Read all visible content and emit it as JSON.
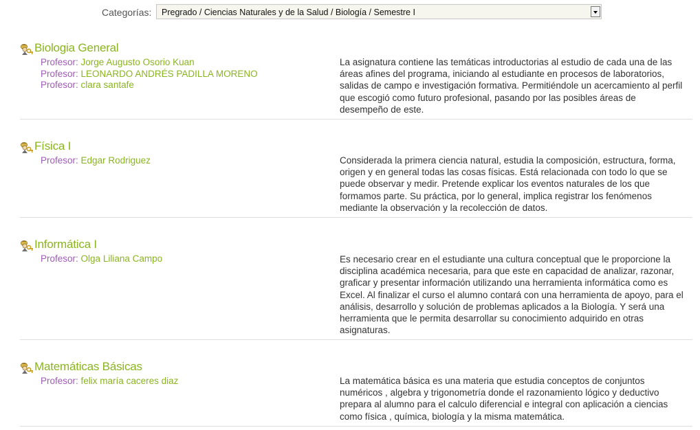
{
  "categories": {
    "label": "Categorías:",
    "selected": "Pregrado / Ciencias Naturales y de la Salud / Biología / Semestre I"
  },
  "teacher_label": "Profesor:",
  "courses": [
    {
      "name": "Biologia General",
      "teachers": [
        "Jorge Augusto Osorio Kuan",
        "LEONARDO ANDRÉS PADILLA MORENO",
        "clara santafe"
      ],
      "summary": "La asignatura contiene las temáticas introductorias al estudio  de cada una de las áreas afines del programa, iniciando al estudiante en procesos de laboratorios,  salidas de campo e investigación formativa. Permitiéndole un acercamiento al perfil que escogió como futuro profesional, pasando por las posibles áreas de desempeño de este."
    },
    {
      "name": "Física I",
      "teachers": [
        "Edgar Rodriguez"
      ],
      "summary": "Considerada la primera ciencia natural, estudia la composición, estructura, forma, origen y en general todas las cosas físicas. Está relacionada con todo lo que se puede observar  y medir. Pretende explicar los eventos naturales de los que formamos parte. Su práctica, por lo general, implica registrar los fenómenos mediante la observación y la recolección de datos."
    },
    {
      "name": "Informática I",
      "teachers": [
        "Olga Liliana Campo"
      ],
      "summary": "Es necesario crear en el estudiante una cultura conceptual que le proporcione la disciplina académica necesaria, para que este en capacidad de analizar, razonar, graficar y presentar información utilizando una herramienta informática como es Excel. Al finalizar el curso el alumno contará con una herramienta de apoyo, para el análisis, desarrollo y solución de problemas aplicados a la Biología. Y será una herramienta que le permita desarrollar su conocimiento adquirido en otras asignaturas."
    },
    {
      "name": "Matemáticas Básicas",
      "teachers": [
        "felix maría caceres diaz"
      ],
      "summary": "La matemática básica es una materia que estudia conceptos de conjuntos numéricos , algebra y trigonometría donde el razonamiento lógico y deductivo prepara al alumno para el calculo diferencial e integral con aplicación a ciencias como física , química, biología y la misma matemática."
    }
  ]
}
